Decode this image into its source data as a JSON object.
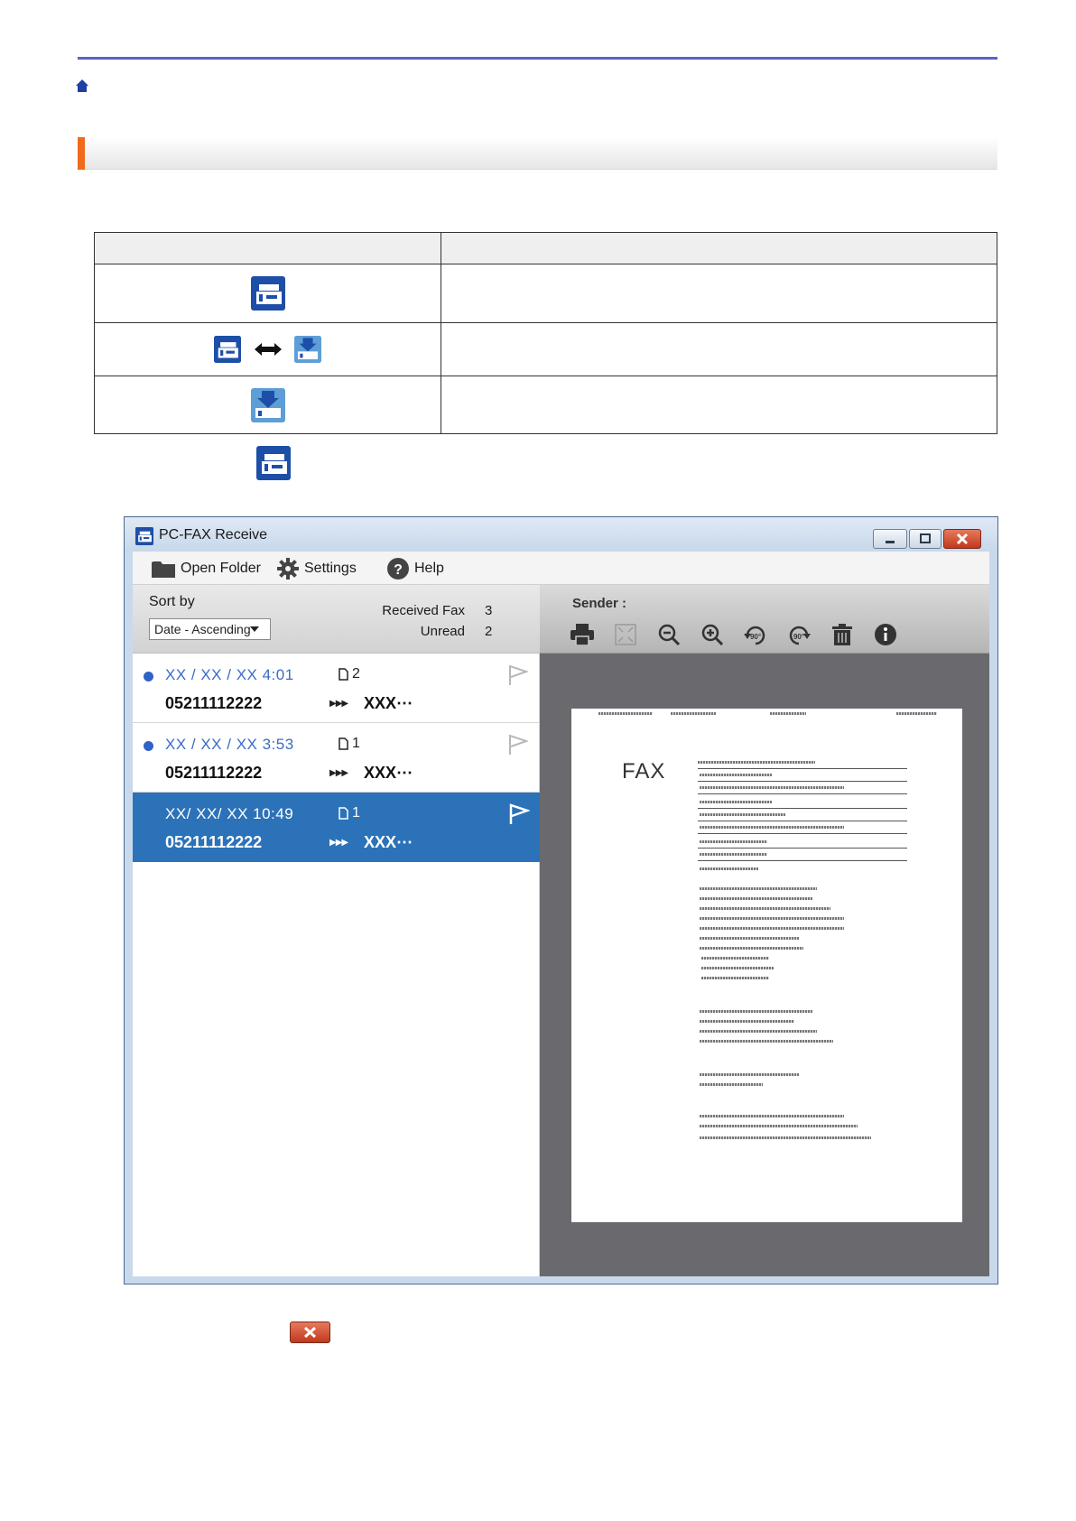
{
  "window": {
    "title": "PC-FAX Receive",
    "menu": {
      "open_folder": "Open Folder",
      "settings": "Settings",
      "help": "Help"
    },
    "sort": {
      "label": "Sort by",
      "selected": "Date - Ascending"
    },
    "stats": {
      "received_label": "Received Fax",
      "received_value": "3",
      "unread_label": "Unread",
      "unread_value": "2"
    },
    "preview": {
      "sender_label": "Sender :",
      "fax_word": "FAX"
    },
    "faxes": [
      {
        "date": "XX / XX / XX  4:01",
        "pages": "2",
        "number": "05211112222",
        "name": "XXX⋯",
        "unread": true,
        "flagged": false,
        "selected": false
      },
      {
        "date": "XX / XX / XX  3:53",
        "pages": "1",
        "number": "05211112222",
        "name": "XXX⋯",
        "unread": true,
        "flagged": false,
        "selected": false
      },
      {
        "date": "XX/ XX/ XX 10:49",
        "pages": "1",
        "number": "05211112222",
        "name": "XXX⋯",
        "unread": false,
        "flagged": true,
        "selected": true
      }
    ],
    "arrows": "▶▶▶"
  },
  "colors": {
    "accent_rule": "#5b62c7",
    "section_accent": "#ef6a1a",
    "selected_row": "#2c72b8",
    "unread_dot": "#2f63c5"
  }
}
